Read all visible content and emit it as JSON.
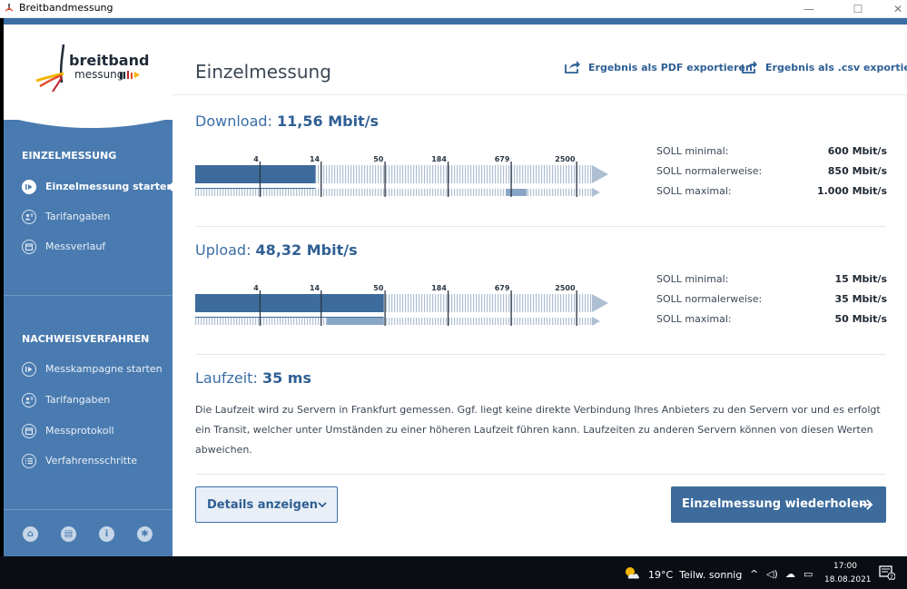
{
  "window": {
    "title": "Breitbandmessung",
    "minimize": "—",
    "maximize": "☐",
    "close": "✕"
  },
  "logo": {
    "line1": "breitband",
    "line2": "messung"
  },
  "sidebar": {
    "section1": "EINZELMESSUNG",
    "items1": [
      {
        "label": "Einzelmessung starten",
        "icon": "play-circle-icon",
        "active": true
      },
      {
        "label": "Tarifangaben",
        "icon": "user-group-icon"
      },
      {
        "label": "Messverlauf",
        "icon": "calendar-icon"
      }
    ],
    "section2": "NACHWEISVERFAHREN",
    "items2": [
      {
        "label": "Messkampagne starten",
        "icon": "play-circle-icon"
      },
      {
        "label": "Tarifangaben",
        "icon": "user-group-icon"
      },
      {
        "label": "Messprotokoll",
        "icon": "calendar-icon"
      },
      {
        "label": "Verfahrensschritte",
        "icon": "list-icon"
      }
    ],
    "footer_icons": [
      "home-icon",
      "chat-icon",
      "info-icon",
      "gear-icon"
    ]
  },
  "header": {
    "title": "Einzelmessung",
    "export_pdf": "Ergebnis als PDF exportieren",
    "export_csv": "Ergebnis als .csv exportieren"
  },
  "scale_ticks": [
    "4",
    "14",
    "50",
    "184",
    "679",
    "2500"
  ],
  "download": {
    "label": "Download:",
    "value": "11,56 Mbit/s",
    "measured_fraction": 0.303,
    "soll_range_fraction": [
      0.783,
      0.836
    ],
    "soll": [
      {
        "k": "SOLL minimal:",
        "v": "600 Mbit/s"
      },
      {
        "k": "SOLL normalerweise:",
        "v": "850 Mbit/s"
      },
      {
        "k": "SOLL maximal:",
        "v": "1.000 Mbit/s"
      }
    ]
  },
  "upload": {
    "label": "Upload:",
    "value": "48,32 Mbit/s",
    "measured_fraction": 0.475,
    "soll_range_fraction": [
      0.332,
      0.475
    ],
    "soll": [
      {
        "k": "SOLL minimal:",
        "v": "15 Mbit/s"
      },
      {
        "k": "SOLL normalerweise:",
        "v": "35 Mbit/s"
      },
      {
        "k": "SOLL maximal:",
        "v": "50 Mbit/s"
      }
    ]
  },
  "latency": {
    "label": "Laufzeit:",
    "value": "35 ms",
    "description": "Die Laufzeit wird zu Servern in Frankfurt gemessen. Ggf. liegt keine direkte Verbindung Ihres Anbieters zu den Servern vor und es erfolgt ein Transit, welcher unter Umständen zu einer höheren Laufzeit führen kann. Laufzeiten zu anderen Servern können von diesen Werten abweichen."
  },
  "buttons": {
    "details": "Details anzeigen",
    "repeat": "Einzelmessung wiederholen"
  },
  "taskbar": {
    "weather_temp": "19°C",
    "weather_text": "Teilw. sonnig",
    "time": "17:00",
    "date": "18.08.2021",
    "notification_count": "2"
  },
  "colors": {
    "sidebar": "#4a7bb0",
    "accent": "#3a6ea5",
    "bar_fill": "#3d6b9c",
    "soll_band": "#a9c0da"
  }
}
